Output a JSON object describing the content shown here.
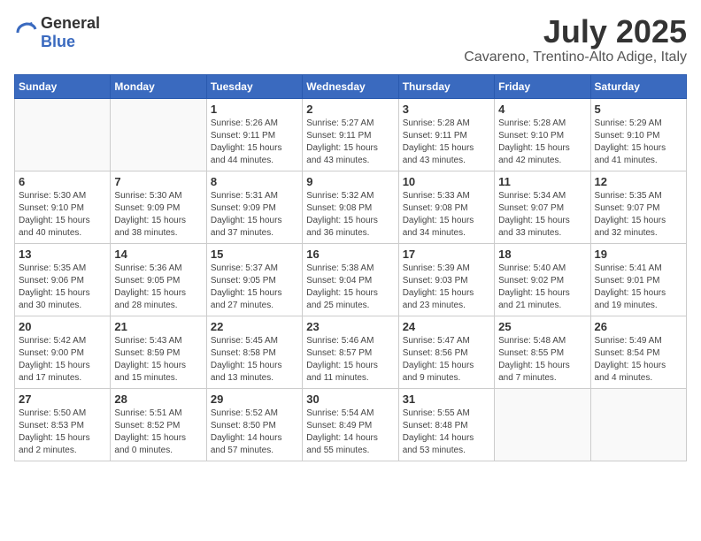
{
  "header": {
    "logo_general": "General",
    "logo_blue": "Blue",
    "month": "July 2025",
    "location": "Cavareno, Trentino-Alto Adige, Italy"
  },
  "weekdays": [
    "Sunday",
    "Monday",
    "Tuesday",
    "Wednesday",
    "Thursday",
    "Friday",
    "Saturday"
  ],
  "weeks": [
    [
      {
        "day": "",
        "info": ""
      },
      {
        "day": "",
        "info": ""
      },
      {
        "day": "1",
        "info": "Sunrise: 5:26 AM\nSunset: 9:11 PM\nDaylight: 15 hours\nand 44 minutes."
      },
      {
        "day": "2",
        "info": "Sunrise: 5:27 AM\nSunset: 9:11 PM\nDaylight: 15 hours\nand 43 minutes."
      },
      {
        "day": "3",
        "info": "Sunrise: 5:28 AM\nSunset: 9:11 PM\nDaylight: 15 hours\nand 43 minutes."
      },
      {
        "day": "4",
        "info": "Sunrise: 5:28 AM\nSunset: 9:10 PM\nDaylight: 15 hours\nand 42 minutes."
      },
      {
        "day": "5",
        "info": "Sunrise: 5:29 AM\nSunset: 9:10 PM\nDaylight: 15 hours\nand 41 minutes."
      }
    ],
    [
      {
        "day": "6",
        "info": "Sunrise: 5:30 AM\nSunset: 9:10 PM\nDaylight: 15 hours\nand 40 minutes."
      },
      {
        "day": "7",
        "info": "Sunrise: 5:30 AM\nSunset: 9:09 PM\nDaylight: 15 hours\nand 38 minutes."
      },
      {
        "day": "8",
        "info": "Sunrise: 5:31 AM\nSunset: 9:09 PM\nDaylight: 15 hours\nand 37 minutes."
      },
      {
        "day": "9",
        "info": "Sunrise: 5:32 AM\nSunset: 9:08 PM\nDaylight: 15 hours\nand 36 minutes."
      },
      {
        "day": "10",
        "info": "Sunrise: 5:33 AM\nSunset: 9:08 PM\nDaylight: 15 hours\nand 34 minutes."
      },
      {
        "day": "11",
        "info": "Sunrise: 5:34 AM\nSunset: 9:07 PM\nDaylight: 15 hours\nand 33 minutes."
      },
      {
        "day": "12",
        "info": "Sunrise: 5:35 AM\nSunset: 9:07 PM\nDaylight: 15 hours\nand 32 minutes."
      }
    ],
    [
      {
        "day": "13",
        "info": "Sunrise: 5:35 AM\nSunset: 9:06 PM\nDaylight: 15 hours\nand 30 minutes."
      },
      {
        "day": "14",
        "info": "Sunrise: 5:36 AM\nSunset: 9:05 PM\nDaylight: 15 hours\nand 28 minutes."
      },
      {
        "day": "15",
        "info": "Sunrise: 5:37 AM\nSunset: 9:05 PM\nDaylight: 15 hours\nand 27 minutes."
      },
      {
        "day": "16",
        "info": "Sunrise: 5:38 AM\nSunset: 9:04 PM\nDaylight: 15 hours\nand 25 minutes."
      },
      {
        "day": "17",
        "info": "Sunrise: 5:39 AM\nSunset: 9:03 PM\nDaylight: 15 hours\nand 23 minutes."
      },
      {
        "day": "18",
        "info": "Sunrise: 5:40 AM\nSunset: 9:02 PM\nDaylight: 15 hours\nand 21 minutes."
      },
      {
        "day": "19",
        "info": "Sunrise: 5:41 AM\nSunset: 9:01 PM\nDaylight: 15 hours\nand 19 minutes."
      }
    ],
    [
      {
        "day": "20",
        "info": "Sunrise: 5:42 AM\nSunset: 9:00 PM\nDaylight: 15 hours\nand 17 minutes."
      },
      {
        "day": "21",
        "info": "Sunrise: 5:43 AM\nSunset: 8:59 PM\nDaylight: 15 hours\nand 15 minutes."
      },
      {
        "day": "22",
        "info": "Sunrise: 5:45 AM\nSunset: 8:58 PM\nDaylight: 15 hours\nand 13 minutes."
      },
      {
        "day": "23",
        "info": "Sunrise: 5:46 AM\nSunset: 8:57 PM\nDaylight: 15 hours\nand 11 minutes."
      },
      {
        "day": "24",
        "info": "Sunrise: 5:47 AM\nSunset: 8:56 PM\nDaylight: 15 hours\nand 9 minutes."
      },
      {
        "day": "25",
        "info": "Sunrise: 5:48 AM\nSunset: 8:55 PM\nDaylight: 15 hours\nand 7 minutes."
      },
      {
        "day": "26",
        "info": "Sunrise: 5:49 AM\nSunset: 8:54 PM\nDaylight: 15 hours\nand 4 minutes."
      }
    ],
    [
      {
        "day": "27",
        "info": "Sunrise: 5:50 AM\nSunset: 8:53 PM\nDaylight: 15 hours\nand 2 minutes."
      },
      {
        "day": "28",
        "info": "Sunrise: 5:51 AM\nSunset: 8:52 PM\nDaylight: 15 hours\nand 0 minutes."
      },
      {
        "day": "29",
        "info": "Sunrise: 5:52 AM\nSunset: 8:50 PM\nDaylight: 14 hours\nand 57 minutes."
      },
      {
        "day": "30",
        "info": "Sunrise: 5:54 AM\nSunset: 8:49 PM\nDaylight: 14 hours\nand 55 minutes."
      },
      {
        "day": "31",
        "info": "Sunrise: 5:55 AM\nSunset: 8:48 PM\nDaylight: 14 hours\nand 53 minutes."
      },
      {
        "day": "",
        "info": ""
      },
      {
        "day": "",
        "info": ""
      }
    ]
  ]
}
